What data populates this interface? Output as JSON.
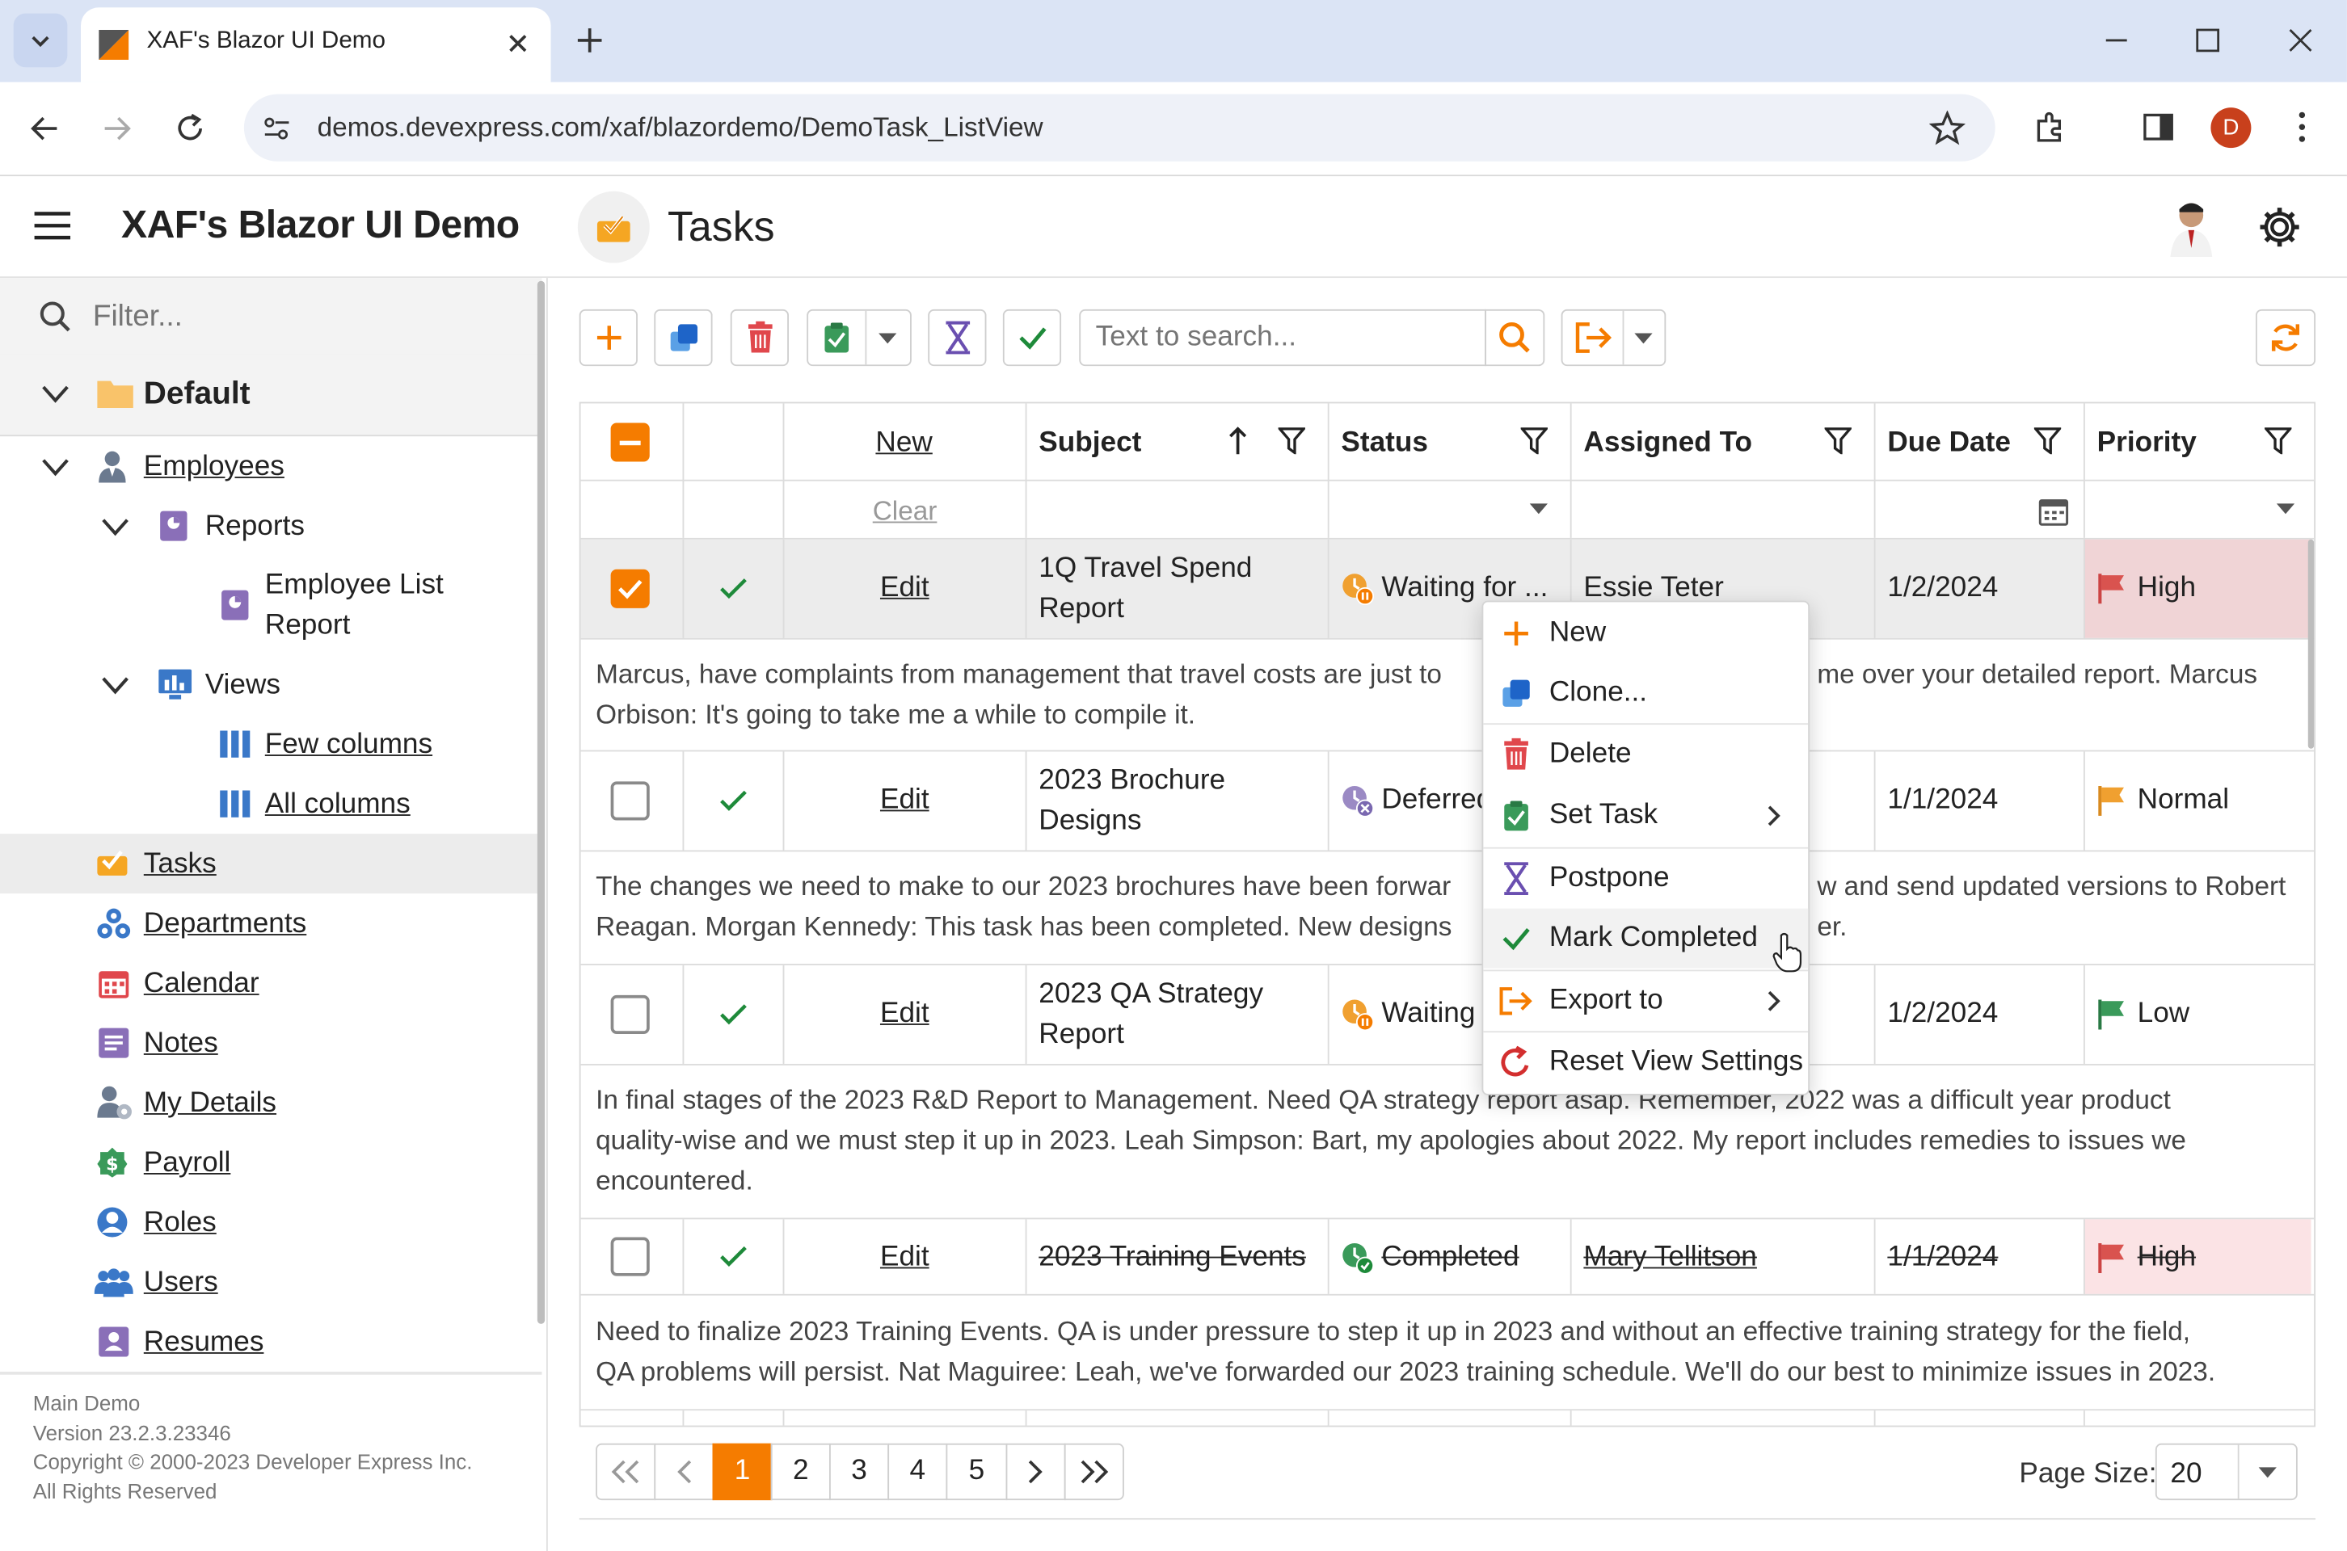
{
  "browser": {
    "tab_title": "XAF's Blazor UI Demo",
    "url": "demos.devexpress.com/xaf/blazordemo/DemoTask_ListView",
    "profile_initial": "D",
    "accent": "#dbe4f5"
  },
  "app": {
    "title": "XAF's Blazor UI Demo",
    "view_title": "Tasks"
  },
  "sidebar": {
    "filter_placeholder": "Filter...",
    "group": "Default",
    "items": [
      {
        "label": "Employees",
        "icon": "employee-icon"
      },
      {
        "label": "Reports",
        "icon": "report-icon"
      },
      {
        "label": "Employee List",
        "label2": "Report",
        "icon": "report-doc-icon"
      },
      {
        "label": "Views",
        "icon": "views-icon"
      },
      {
        "label": "Few columns",
        "icon": "columns-icon"
      },
      {
        "label": "All columns",
        "icon": "columns-icon"
      },
      {
        "label": "Tasks",
        "icon": "tasks-icon"
      },
      {
        "label": "Departments",
        "icon": "departments-icon"
      },
      {
        "label": "Calendar",
        "icon": "calendar-icon"
      },
      {
        "label": "Notes",
        "icon": "notes-icon"
      },
      {
        "label": "My Details",
        "icon": "my-details-icon"
      },
      {
        "label": "Payroll",
        "icon": "payroll-icon"
      },
      {
        "label": "Roles",
        "icon": "roles-icon"
      },
      {
        "label": "Users",
        "icon": "users-icon"
      },
      {
        "label": "Resumes",
        "icon": "resumes-icon"
      }
    ],
    "footer": {
      "line1": "Main Demo",
      "line2": "Version 23.2.3.23346",
      "line3": "Copyright © 2000-2023 Developer Express Inc.",
      "line4": "All Rights Reserved"
    }
  },
  "toolbar": {
    "search_placeholder": "Text to search..."
  },
  "grid": {
    "columns": {
      "new": "New",
      "subject": "Subject",
      "status": "Status",
      "assigned_to": "Assigned To",
      "due_date": "Due Date",
      "priority": "Priority"
    },
    "filter_row": {
      "clear": "Clear"
    },
    "rows": [
      {
        "edit": "Edit",
        "subject_1": "1Q Travel Spend",
        "subject_2": "Report",
        "status": "Waiting for ...",
        "assigned_to": "Essie Teter",
        "due_date": "1/2/2024",
        "priority": "High",
        "preview": "Marcus, have complaints from management that travel costs are just to",
        "preview_right": "me over your detailed report. Marcus",
        "preview_2": "Orbison: It's going to take me a while to compile it."
      },
      {
        "edit": "Edit",
        "subject_1": "2023 Brochure",
        "subject_2": "Designs",
        "status": "Deferred",
        "due_date": "1/1/2024",
        "priority": "Normal",
        "preview": "The changes we need to make to our 2023 brochures have been forwar",
        "preview_right": "w and send updated versions to Robert",
        "preview_2": "Reagan. Morgan Kennedy: This task has been completed. New designs",
        "preview_2_right": "er."
      },
      {
        "edit": "Edit",
        "subject_1": "2023 QA Strategy",
        "subject_2": "Report",
        "status": "Waiting",
        "due_date": "1/2/2024",
        "priority": "Low",
        "preview": "In final stages of the 2023 R&D Report to Management. Need QA strategy report asap. Remember, 2022 was a difficult year product",
        "preview_2": "quality-wise and we must step it up in 2023. Leah Simpson: Bart, my apologies about 2022. My report includes remedies to issues we",
        "preview_3": "encountered."
      },
      {
        "edit": "Edit",
        "subject_1": "2023 Training Events",
        "status": "Completed",
        "assigned_to": "Mary Tellitson",
        "due_date": "1/1/2024",
        "priority": "High",
        "preview": "Need to finalize 2023 Training Events. QA is under pressure to step it up in 2023 and without an effective training strategy for the field,",
        "preview_2": "QA problems will persist. Nat Maguiree: Leah, we've forwarded our 2023 training schedule. We'll do our best to minimize issues in 2023."
      }
    ],
    "colors": {
      "high": "#f0d4d6",
      "high_flag": "#d9534f",
      "normal_flag": "#f0a030",
      "low_flag": "#3a9a5a",
      "accent": "#f57c00"
    }
  },
  "context_menu": {
    "items": [
      {
        "label": "New",
        "icon": "plus-icon"
      },
      {
        "label": "Clone...",
        "icon": "clone-icon"
      },
      {
        "label": "Delete",
        "icon": "trash-icon"
      },
      {
        "label": "Set Task",
        "icon": "clipboard-icon"
      },
      {
        "label": "Postpone",
        "icon": "hourglass-icon"
      },
      {
        "label": "Mark Completed",
        "icon": "check-icon"
      },
      {
        "label": "Export to",
        "icon": "export-icon"
      },
      {
        "label": "Reset View Settings",
        "icon": "reset-icon"
      }
    ]
  },
  "pager": {
    "pages": [
      "1",
      "2",
      "3",
      "4",
      "5"
    ],
    "current": "1",
    "page_size_label": "Page Size:",
    "page_size": "20"
  }
}
